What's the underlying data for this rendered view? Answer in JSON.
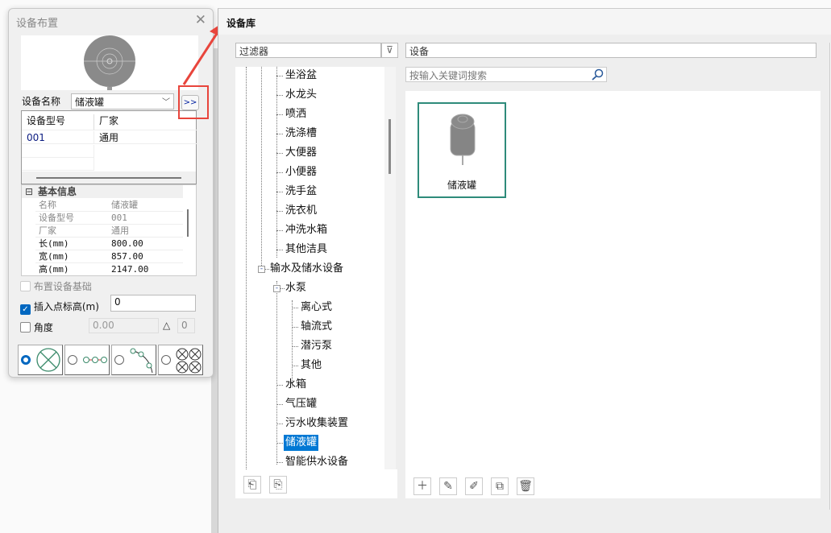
{
  "left_dialog": {
    "title": "设备布置",
    "name_label": "设备名称",
    "name_value": "储液罐",
    "more_button": ">>",
    "grid": {
      "headers": [
        "设备型号",
        "厂家"
      ],
      "rows": [
        [
          "001",
          "通用"
        ]
      ]
    },
    "props": {
      "group": "基本信息",
      "rows": [
        [
          "名称",
          "储液罐"
        ],
        [
          "设备型号",
          "001"
        ],
        [
          "厂家",
          "通用"
        ],
        [
          "长(mm)",
          "800.00"
        ],
        [
          "宽(mm)",
          "857.00"
        ],
        [
          "高(mm)",
          "2147.00"
        ]
      ]
    },
    "base_checkbox": "布置设备基础",
    "insert_checkbox": "插入点标高(m)",
    "insert_value": "0",
    "angle_checkbox": "角度",
    "angle_value": "0.00",
    "delta_symbol": "△",
    "delta_value": "0"
  },
  "main": {
    "title": "设备库",
    "filter_placeholder": "过滤器",
    "category": "设备",
    "search_placeholder": "按输入关键词搜索",
    "tree": [
      "坐浴盆",
      "水龙头",
      "喷洒",
      "洗涤槽",
      "大便器",
      "小便器",
      "洗手盆",
      "洗衣机",
      "冲洗水箱",
      "其他洁具",
      "输水及储水设备",
      "水泵",
      "离心式",
      "轴流式",
      "潜污泵",
      "其他",
      "水箱",
      "气压罐",
      "污水收集装置",
      "储液罐",
      "智能供水设备"
    ],
    "card_label": "储液罐",
    "accent": "#2e8b7a",
    "selection": "#0078d4"
  }
}
